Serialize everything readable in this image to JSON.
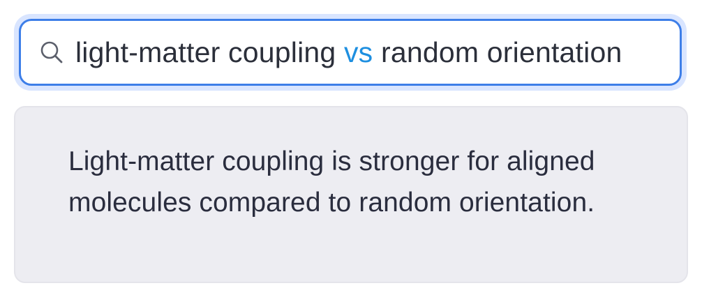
{
  "search": {
    "query_before": "light-matter coupling ",
    "query_operator": "vs",
    "query_after": " random orientation",
    "icon": "search-icon",
    "accent_color": "#3d7ee8",
    "operator_color": "#1e8fe0"
  },
  "result": {
    "text": "Light-matter coupling is stronger for aligned molecules compared to random orientation."
  }
}
